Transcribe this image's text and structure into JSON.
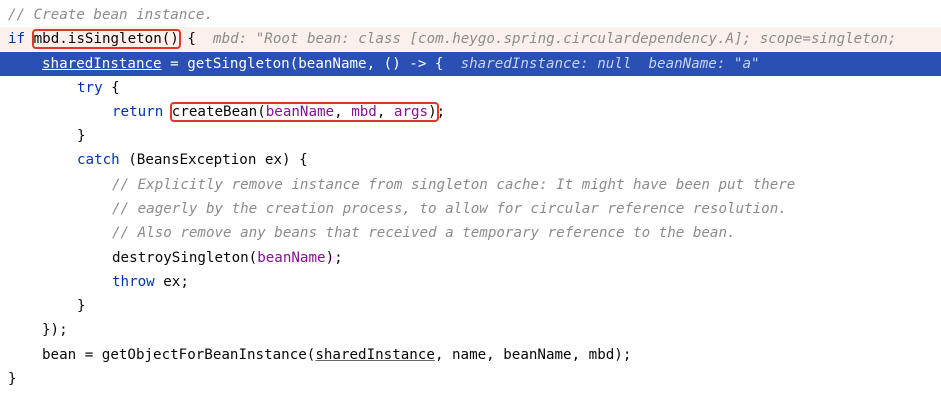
{
  "code": {
    "comment_create": "// Create bean instance.",
    "if_kw": "if",
    "mbd_call": "mbd.isSingleton()",
    "open_brace": " {",
    "mbd_hint": "mbd: \"Root bean: class [com.heygo.spring.circulardependency.A]; scope=singleton;",
    "shared_instance": "sharedInstance",
    "assign_get_singleton": " = getSingleton(beanName, () -> {",
    "hint_shared": "sharedInstance: null",
    "hint_beanname": "beanName: \"a\"",
    "try_kw": "try",
    "try_brace": " {",
    "return_kw": "return",
    "create_bean": "createBean",
    "cb_paren_open": "(",
    "cb_arg_beanname": "beanName",
    "cb_comma1": ", ",
    "cb_arg_mbd": "mbd",
    "cb_comma2": ", ",
    "cb_arg_args": "args",
    "cb_paren_close": ")",
    "semicolon": ";",
    "close_brace": "}",
    "catch_kw": "catch",
    "catch_rest": " (BeansException ex) {",
    "comment1": "// Explicitly remove instance from singleton cache: It might have been put there",
    "comment2": "// eagerly by the creation process, to allow for circular reference resolution.",
    "comment3": "// Also remove any beans that received a temporary reference to the bean.",
    "destroy_call": "destroySingleton(",
    "destroy_arg": "beanName",
    "destroy_end": ");",
    "throw_kw": "throw",
    "throw_rest": " ex;",
    "close_lambda": "});",
    "bean_assign": "bean = getObjectForBeanInstance(",
    "bean_arg_shared": "sharedInstance",
    "bean_arg_rest": ", name, beanName, mbd);",
    "final_brace": "}"
  }
}
